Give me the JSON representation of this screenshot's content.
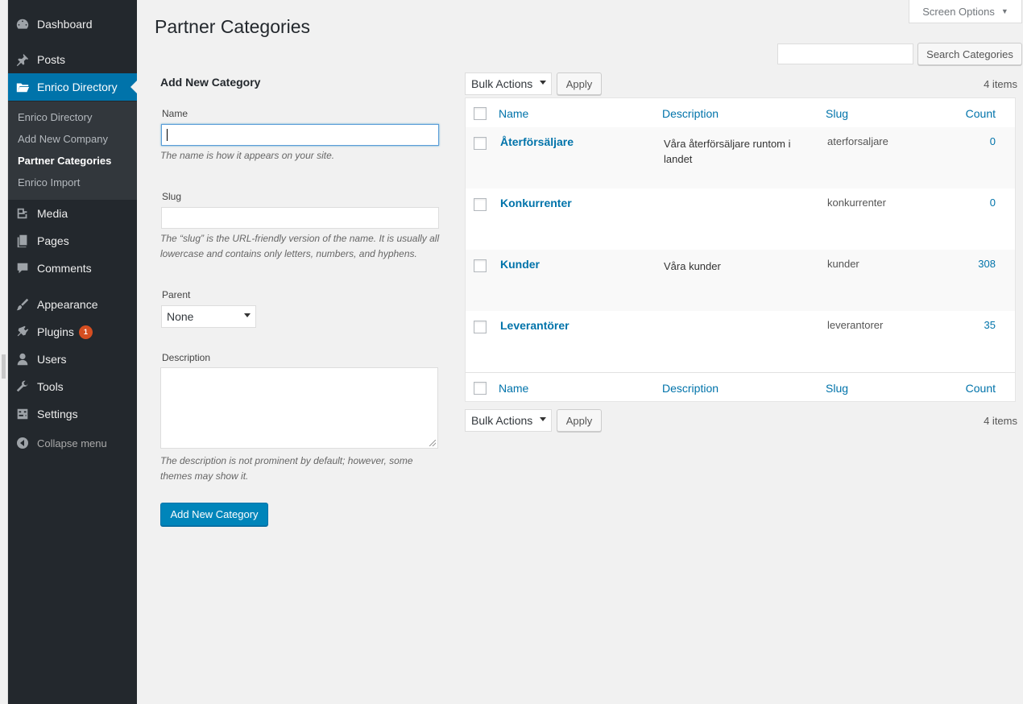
{
  "sidebar": {
    "items": [
      {
        "label": "Dashboard",
        "icon": "dashboard-icon"
      },
      {
        "label": "Posts",
        "icon": "pushpin-icon"
      },
      {
        "label": "Enrico Directory",
        "icon": "folder-icon"
      },
      {
        "label": "Media",
        "icon": "media-icon"
      },
      {
        "label": "Pages",
        "icon": "pages-icon"
      },
      {
        "label": "Comments",
        "icon": "comments-icon"
      },
      {
        "label": "Appearance",
        "icon": "paintbrush-icon"
      },
      {
        "label": "Plugins",
        "icon": "plugin-icon"
      },
      {
        "label": "Users",
        "icon": "user-icon"
      },
      {
        "label": "Tools",
        "icon": "wrench-icon"
      },
      {
        "label": "Settings",
        "icon": "settings-icon"
      }
    ],
    "plugins_badge": "1",
    "submenu": [
      "Enrico Directory",
      "Add New Company",
      "Partner Categories",
      "Enrico Import"
    ],
    "collapse_label": "Collapse menu"
  },
  "header": {
    "title": "Partner Categories",
    "screen_options": "Screen Options",
    "search_button": "Search Categories",
    "search_value": ""
  },
  "form": {
    "title": "Add New Category",
    "name_label": "Name",
    "name_value": "",
    "name_help": "The name is how it appears on your site.",
    "slug_label": "Slug",
    "slug_value": "",
    "slug_help": "The “slug” is the URL-friendly version of the name. It is usually all lowercase and contains only letters, numbers, and hyphens.",
    "parent_label": "Parent",
    "parent_value": "None",
    "description_label": "Description",
    "description_value": "",
    "description_help": "The description is not prominent by default; however, some themes may show it.",
    "submit_label": "Add New Category"
  },
  "list": {
    "bulk_actions": "Bulk Actions",
    "apply": "Apply",
    "items_count": "4 items",
    "columns": {
      "name": "Name",
      "description": "Description",
      "slug": "Slug",
      "count": "Count"
    },
    "rows": [
      {
        "name": "Återförsäljare",
        "description": "Våra återförsäljare runtom i landet",
        "slug": "aterforsaljare",
        "count": "0"
      },
      {
        "name": "Konkurrenter",
        "description": "",
        "slug": "konkurrenter",
        "count": "0"
      },
      {
        "name": "Kunder",
        "description": "Våra kunder",
        "slug": "kunder",
        "count": "308"
      },
      {
        "name": "Leverantörer",
        "description": "",
        "slug": "leverantorer",
        "count": "35"
      }
    ]
  },
  "colors": {
    "sidebar_bg": "#23282d",
    "submenu_bg": "#32373c",
    "accent": "#0073aa",
    "primary_button": "#0085ba",
    "badge": "#d54e21"
  }
}
